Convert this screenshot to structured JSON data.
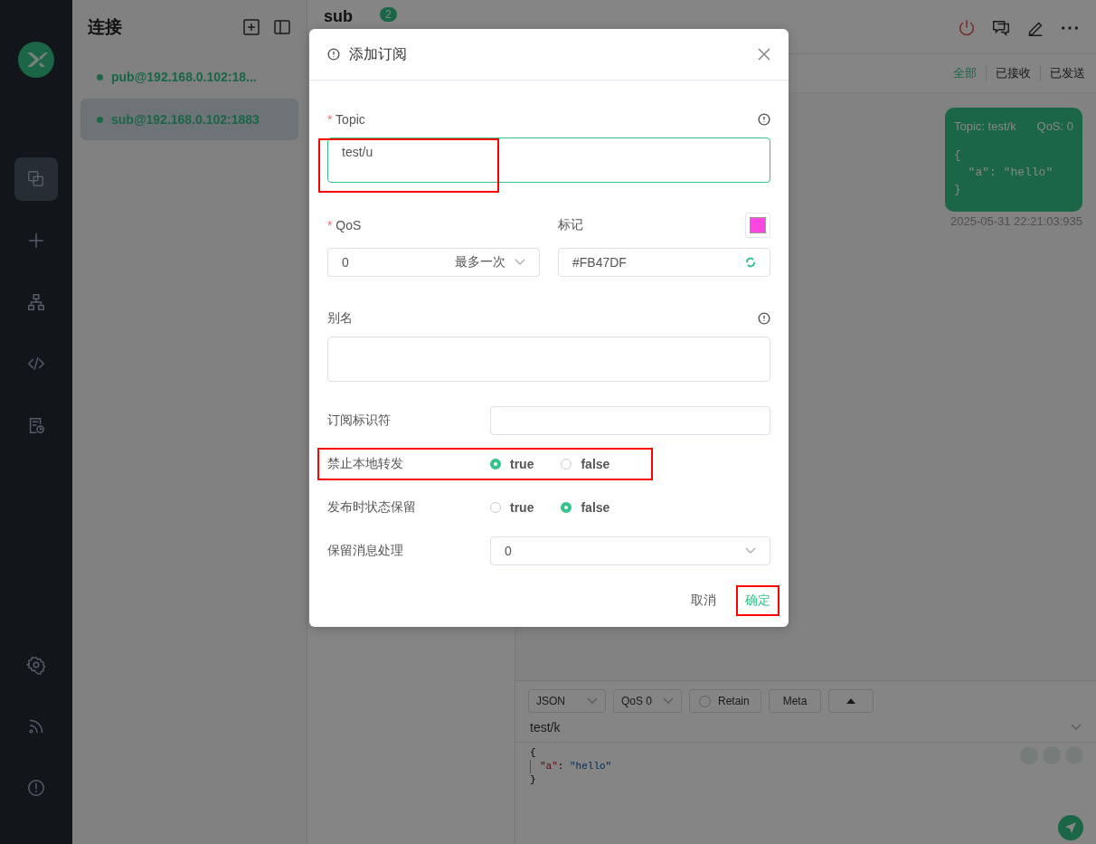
{
  "rail": {
    "items": [
      {
        "kind": "connections",
        "selected": true
      },
      {
        "kind": "new",
        "selected": false
      },
      {
        "kind": "tree",
        "selected": false
      },
      {
        "kind": "script",
        "selected": false
      },
      {
        "kind": "log",
        "selected": false
      }
    ],
    "bottom": [
      {
        "kind": "settings"
      },
      {
        "kind": "feed"
      },
      {
        "kind": "about"
      }
    ]
  },
  "connections": {
    "title": "连接",
    "items": [
      {
        "label": "pub@192.168.0.102:18...",
        "selected": false
      },
      {
        "label": "sub@192.168.0.102:1883",
        "selected": true
      }
    ]
  },
  "header": {
    "title": "sub",
    "badge": "2"
  },
  "filters": [
    {
      "label": "全部",
      "selected": true
    },
    {
      "label": "已接收",
      "selected": false
    },
    {
      "label": "已发送",
      "selected": false
    }
  ],
  "message": {
    "topic": "Topic: test/k",
    "qos": "QoS: 0",
    "payload": [
      "{",
      "  \"a\": \"hello\"",
      "}"
    ],
    "time": "2025-05-31 22:21:03:935"
  },
  "composer": {
    "format": "JSON",
    "qos": "QoS 0",
    "retain": {
      "label": "Retain",
      "checked": false
    },
    "meta": "Meta",
    "topic": "test/k",
    "payload": [
      "{",
      "\"a\"",
      ": ",
      "\"hello\"",
      "}"
    ]
  },
  "dialog": {
    "title": "添加订阅",
    "topic": {
      "required_mark": "*",
      "label": "Topic",
      "value": "test/u",
      "focused": true,
      "highlight": true
    },
    "qos": {
      "required_mark": "*",
      "label": "QoS",
      "value": "0",
      "hint": "最多一次"
    },
    "mark": {
      "label": "标记",
      "value": "#FB47DF",
      "color": "#fb47df"
    },
    "alias": {
      "label": "别名"
    },
    "sub_id": {
      "label": "订阅标识符"
    },
    "radios": [
      {
        "label": "禁止本地转发",
        "highlight": true,
        "options": [
          {
            "label": "true",
            "selected": true
          },
          {
            "label": "false",
            "selected": false
          }
        ]
      },
      {
        "label": "发布时状态保留",
        "highlight": false,
        "options": [
          {
            "label": "true",
            "selected": false
          },
          {
            "label": "false",
            "selected": true
          }
        ]
      }
    ],
    "retain_handling": {
      "label": "保留消息处理",
      "value": "0"
    },
    "buttons": [
      {
        "kind": "cancel",
        "label": "取消",
        "highlight": false
      },
      {
        "kind": "confirm",
        "label": "确定",
        "highlight": true
      }
    ]
  }
}
